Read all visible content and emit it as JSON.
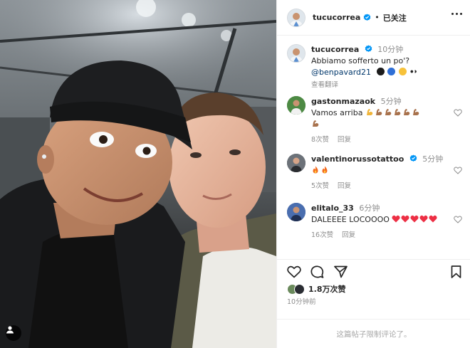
{
  "post": {
    "author": "tucucorrea",
    "separator": "•",
    "follow_label": "已关注",
    "more_icon": "more-horizontal-icon",
    "user_tag_icon": "person-tag-icon"
  },
  "caption": {
    "username": "tucucorrea",
    "time": "10分钟",
    "text": "Abbiamo sofferto un po'?",
    "mention": "@benpavard21",
    "translate_label": "查看翻译"
  },
  "comments": [
    {
      "username": "gastonmazaok",
      "verified": false,
      "time": "5分钟",
      "text": "Vamos arriba",
      "likes": "8次赞",
      "reply": "回复"
    },
    {
      "username": "valentinorussotattoo",
      "verified": true,
      "time": "5分钟",
      "text": "",
      "likes": "5次赞",
      "reply": "回复"
    },
    {
      "username": "elitalo_33",
      "verified": false,
      "time": "6分钟",
      "text": "DALEEEE LOCOOOO",
      "likes": "16次赞",
      "reply": "回复"
    }
  ],
  "actions": {
    "like_icon": "heart-icon",
    "comment_icon": "comment-icon",
    "share_icon": "share-icon",
    "save_icon": "bookmark-icon"
  },
  "likes_count": "1.8万次赞",
  "posted_time": "10分钟前",
  "comments_limited": "这篇帖子限制评论了。",
  "colors": {
    "verified": "#0095f6",
    "text": "#262626",
    "secondary": "#8e8e8e",
    "mention": "#00376b",
    "heart": "#ed2f44"
  }
}
